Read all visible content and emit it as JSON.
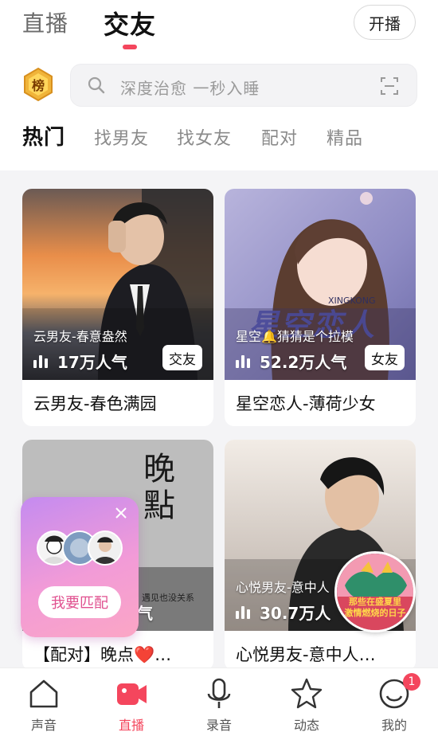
{
  "header": {
    "tabs": [
      {
        "label": "直播",
        "active": false
      },
      {
        "label": "交友",
        "active": true
      }
    ],
    "start_live_label": "开播",
    "accent_color": "#f4465d"
  },
  "rank_badge": {
    "label": "榜",
    "icon": "rank-badge-icon"
  },
  "search": {
    "placeholder": "深度治愈 一秒入睡",
    "icon": "search-icon",
    "scan_icon": "scan-icon"
  },
  "categories": [
    "热门",
    "找男友",
    "找女友",
    "配对",
    "精品"
  ],
  "active_category": "热门",
  "rooms": [
    {
      "name": "云男友-春色满园",
      "subtitle": "云男友-春意盎然",
      "popularity": "17万人气",
      "tag": "交友"
    },
    {
      "name": "星空恋人-薄荷少女",
      "subtitle": "星空🔔猜猜是个拉模",
      "popularity": "52.2万人气",
      "tag": "女友",
      "cover_text": "星空恋人",
      "cover_sub": "XINGKONG"
    },
    {
      "name": "【配对】晚点❤️…",
      "subtitle": "",
      "popularity": "气",
      "tag": "",
      "cover_text": "晚點",
      "cover_sub": "遇见也没关系"
    },
    {
      "name": "心悦男友-意中人…",
      "subtitle": "心悦男友-意中人",
      "popularity": "30.7万人",
      "tag": ""
    }
  ],
  "match_popup": {
    "button_label": "我要匹配"
  },
  "promo": {
    "text_line1": "那些在盛夏里",
    "text_line2": "激情燃烧的日子"
  },
  "bottom_nav": [
    {
      "label": "声音",
      "icon": "house-icon",
      "active": false
    },
    {
      "label": "直播",
      "icon": "video-icon",
      "active": true
    },
    {
      "label": "录音",
      "icon": "microphone-icon",
      "active": false
    },
    {
      "label": "动态",
      "icon": "star-icon",
      "active": false
    },
    {
      "label": "我的",
      "icon": "smiley-icon",
      "active": false,
      "badge": "1"
    }
  ]
}
